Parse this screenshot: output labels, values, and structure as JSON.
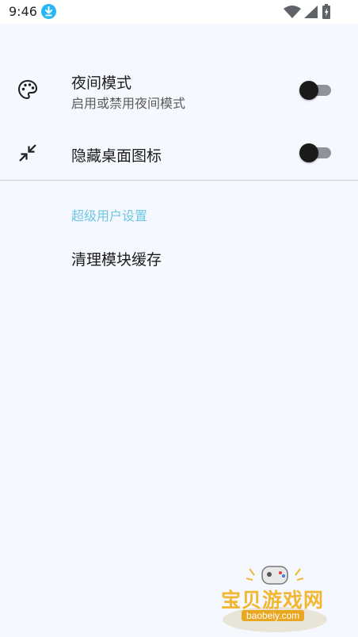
{
  "status_bar": {
    "time": "9:46",
    "download_color": "#29b6f6"
  },
  "settings": {
    "night_mode": {
      "icon": "palette-icon",
      "title": "夜间模式",
      "subtitle": "启用或禁用夜间模式",
      "enabled": false
    },
    "hide_icon": {
      "icon": "minimize-arrows-icon",
      "title": "隐藏桌面图标",
      "enabled": false
    }
  },
  "superuser_section": {
    "header": "超级用户设置",
    "header_color": "#6dc7e4",
    "clear_cache": {
      "title": "清理模块缓存"
    }
  },
  "watermark": {
    "text": "宝贝游戏网",
    "domain": "baobeiy.com"
  }
}
